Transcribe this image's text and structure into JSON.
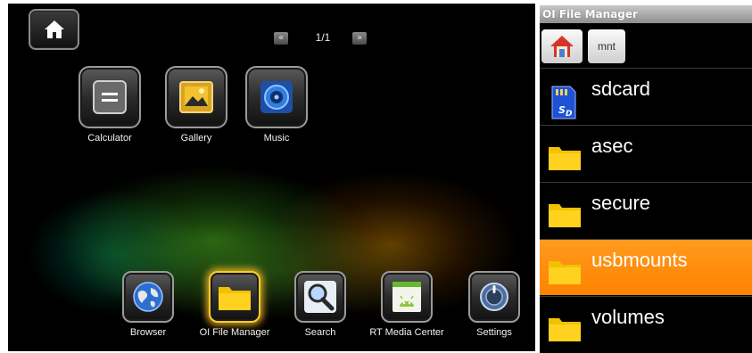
{
  "launcher": {
    "pager": {
      "prev_glyph": "«",
      "next_glyph": "»",
      "indicator": "1/1"
    },
    "apps": [
      {
        "label": "Calculator",
        "icon": "calculator-icon"
      },
      {
        "label": "Gallery",
        "icon": "gallery-icon"
      },
      {
        "label": "Music",
        "icon": "music-speaker-icon"
      }
    ],
    "dock": [
      {
        "label": "Browser",
        "icon": "globe-icon",
        "selected": false
      },
      {
        "label": "OI File Manager",
        "icon": "folder-icon",
        "selected": true
      },
      {
        "label": "Search",
        "icon": "magnifier-icon",
        "selected": false
      },
      {
        "label": "RT Media Center",
        "icon": "media-center-icon",
        "selected": false
      },
      {
        "label": "Settings",
        "icon": "settings-knob-icon",
        "selected": false
      }
    ],
    "colors": {
      "selection_glow": "#ffcc33",
      "background": "#000000"
    }
  },
  "file_manager": {
    "title": "OI File Manager",
    "breadcrumb": {
      "home_icon": "home-icon",
      "current": "mnt"
    },
    "items": [
      {
        "name": "sdcard",
        "icon": "sd-card-icon",
        "selected": false
      },
      {
        "name": "asec",
        "icon": "folder-icon",
        "selected": false
      },
      {
        "name": "secure",
        "icon": "folder-icon",
        "selected": false
      },
      {
        "name": "usbmounts",
        "icon": "folder-icon",
        "selected": true
      },
      {
        "name": "volumes",
        "icon": "folder-icon",
        "selected": false
      }
    ],
    "colors": {
      "selection": "#ff8c00",
      "title_bar": "#a8a8a8"
    }
  }
}
